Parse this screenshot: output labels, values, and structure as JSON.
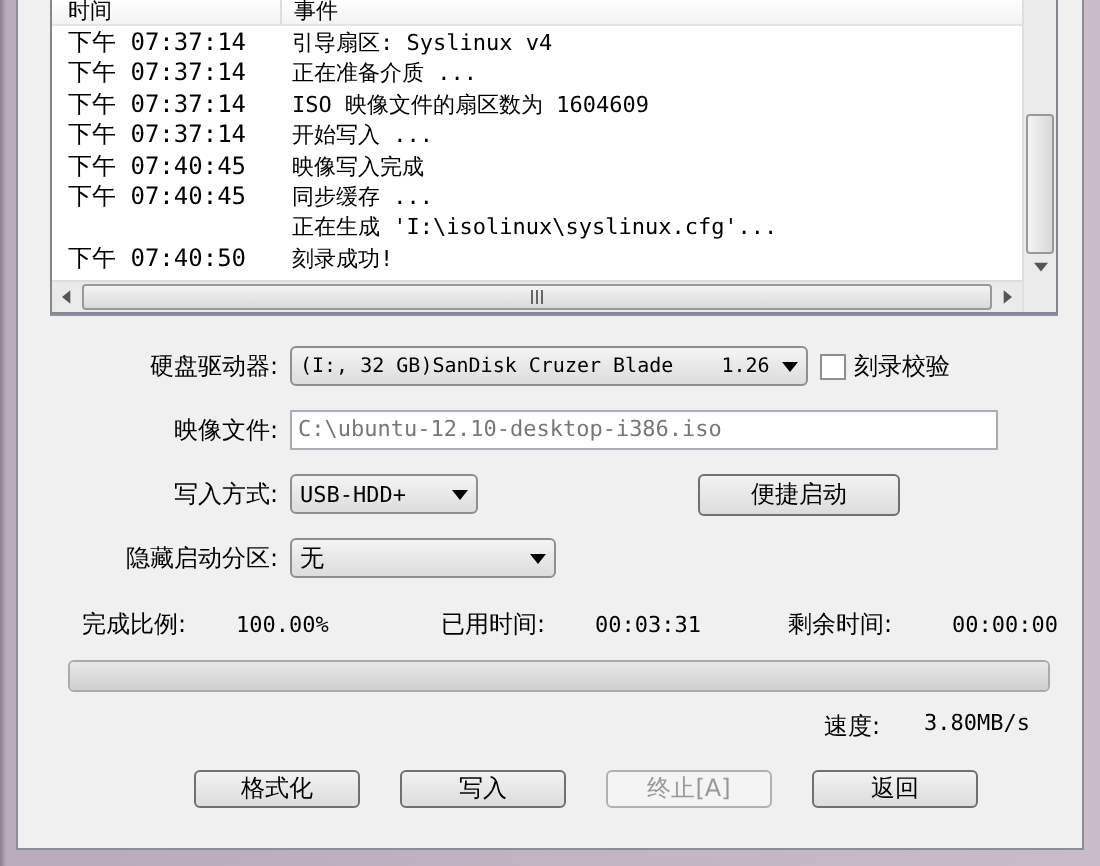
{
  "log": {
    "columns": [
      "时间",
      "事件"
    ],
    "rows": [
      {
        "time": "下午 07:37:14",
        "event": "引导扇区: Syslinux v4"
      },
      {
        "time": "下午 07:37:14",
        "event": "正在准备介质 ..."
      },
      {
        "time": "下午 07:37:14",
        "event": "ISO 映像文件的扇区数为 1604609"
      },
      {
        "time": "下午 07:37:14",
        "event": "开始写入 ..."
      },
      {
        "time": "下午 07:40:45",
        "event": "映像写入完成"
      },
      {
        "time": "下午 07:40:45",
        "event": "同步缓存 ..."
      },
      {
        "event": "正在生成 'I:\\isolinux\\syslinux.cfg'..."
      },
      {
        "time": "下午 07:40:50",
        "event": "刻录成功!"
      }
    ]
  },
  "drive": {
    "label": "硬盘驱动器:",
    "value": "(I:, 32 GB)SanDisk Cruzer Blade    1.26"
  },
  "verify": {
    "label": "刻录校验",
    "checked": false
  },
  "image_file": {
    "label": "映像文件:",
    "value": "C:\\ubuntu-12.10-desktop-i386.iso",
    "disabled": true
  },
  "write_mode": {
    "label": "写入方式:",
    "value": "USB-HDD+"
  },
  "quick_boot_button": {
    "label": "便捷启动"
  },
  "hidden_partition": {
    "label": "隐藏启动分区:",
    "value": "无"
  },
  "stats": [
    {
      "label": "完成比例:",
      "value": "100.00%"
    },
    {
      "label": "已用时间:",
      "value": "00:03:31"
    },
    {
      "label": "剩余时间:",
      "value": "00:00:00"
    }
  ],
  "progress": {
    "level": 1
  },
  "speed": {
    "label": "速度:",
    "value": "3.80MB/s"
  },
  "buttons": [
    {
      "label": "格式化",
      "disabled": false
    },
    {
      "label": "写入",
      "disabled": false
    },
    {
      "label": "终止[A]",
      "disabled": true
    },
    {
      "label": "返回",
      "disabled": false
    }
  ]
}
